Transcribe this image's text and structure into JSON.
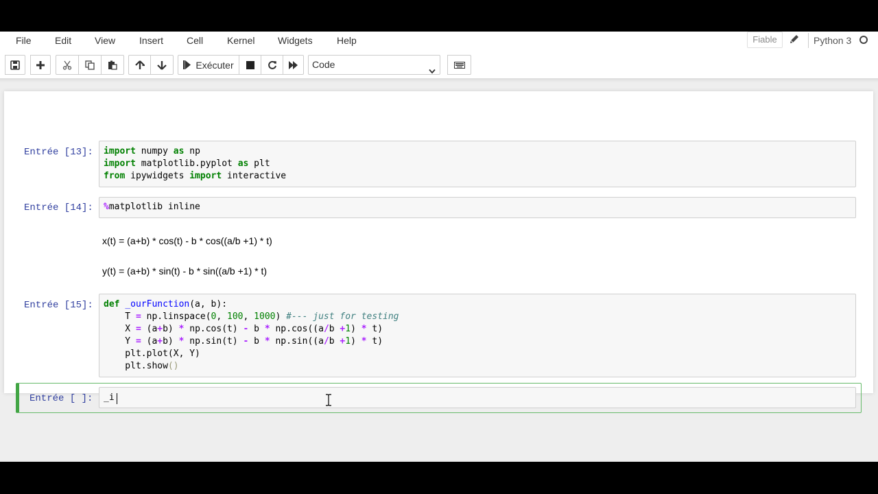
{
  "menubar": {
    "items": [
      "File",
      "Edit",
      "View",
      "Insert",
      "Cell",
      "Kernel",
      "Widgets",
      "Help"
    ],
    "trusted": "Fiable",
    "kernel_name": "Python 3"
  },
  "toolbar": {
    "run_label": "Exécuter",
    "cell_type": "Code",
    "icons": [
      "save-icon",
      "plus-icon",
      "cut-icon",
      "copy-icon",
      "paste-icon",
      "arrow-up-icon",
      "arrow-down-icon",
      "step-forward-icon",
      "stop-icon",
      "refresh-icon",
      "fast-forward-icon",
      "keyboard-icon"
    ]
  },
  "cells": [
    {
      "prompt": "Entrée [13]:",
      "lines": [
        "import numpy as np",
        "import matplotlib.pyplot as plt",
        "from ipywidgets import interactive"
      ]
    },
    {
      "prompt": "Entrée [14]:",
      "lines": [
        "%matplotlib inline"
      ]
    },
    {
      "markdown": [
        "x(t) = (a+b) * cos(t) - b * cos((a/b +1) * t)",
        "y(t) = (a+b) * sin(t) - b * sin((a/b +1) * t)"
      ]
    },
    {
      "prompt": "Entrée [15]:",
      "lines": [
        "def _ourFunction(a, b):",
        "    T = np.linspace(0, 100, 1000) #--- just for testing",
        "    X = (a+b) * np.cos(t) - b * np.cos((a/b +1) * t)",
        "    Y = (a+b) * np.sin(t) - b * np.sin((a/b +1) * t)",
        "    plt.plot(X, Y)",
        "    plt.show()"
      ]
    },
    {
      "prompt": "Entrée [ ]:",
      "lines": [
        "_i"
      ]
    }
  ],
  "colors": {
    "prompt": "#303f9f",
    "keyword": "#008000",
    "operator": "#aa22ff",
    "function_name": "#0000ff",
    "comment": "#408080",
    "active_cell_border": "#42a545"
  }
}
